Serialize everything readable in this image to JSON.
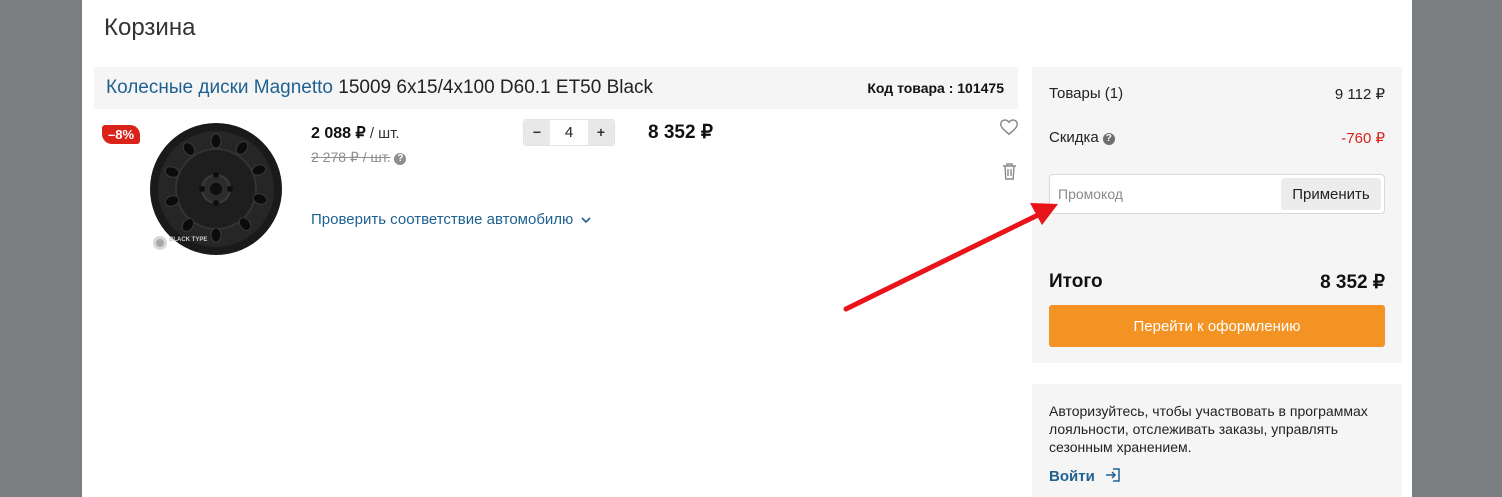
{
  "page": {
    "title": "Корзина"
  },
  "product": {
    "name_link": "Колесные диски Magnetto",
    "name_rest": " 15009 6x15/4x100 D60.1 ET50 Black",
    "sku_label": "Код товара : 101475",
    "discount_badge": "–8%",
    "brand_watermark": "BLACK TYPE",
    "price": "2 088 ₽",
    "price_unit": " / шт.",
    "old_price": "2 278 ₽ / шт.",
    "check_link": "Проверить соответствие автомобилю",
    "quantity": "4",
    "minus_label": "−",
    "plus_label": "+",
    "line_total": "8 352 ₽"
  },
  "summary": {
    "items_label": "Товары (1)",
    "items_value": "9 112 ₽",
    "discount_label": "Скидка",
    "discount_value": "-760 ₽",
    "promo_placeholder": "Промокод",
    "apply_label": "Применить",
    "total_label": "Итого",
    "total_value": "8 352 ₽",
    "checkout_label": "Перейти к оформлению"
  },
  "auth": {
    "text": "Авторизуйтесь, чтобы участвовать в программах лояльности, отслеживать заказы, управлять сезонным хранением.",
    "login_label": "Войти"
  },
  "colors": {
    "accent_link": "#1f6291",
    "discount_red": "#d9241c",
    "checkout_orange": "#f39324",
    "annotation_arrow": "#e8141a"
  },
  "icons": [
    "heart-icon",
    "trash-icon",
    "question-icon",
    "chevron-down-icon",
    "login-icon",
    "minus-icon",
    "plus-icon"
  ]
}
